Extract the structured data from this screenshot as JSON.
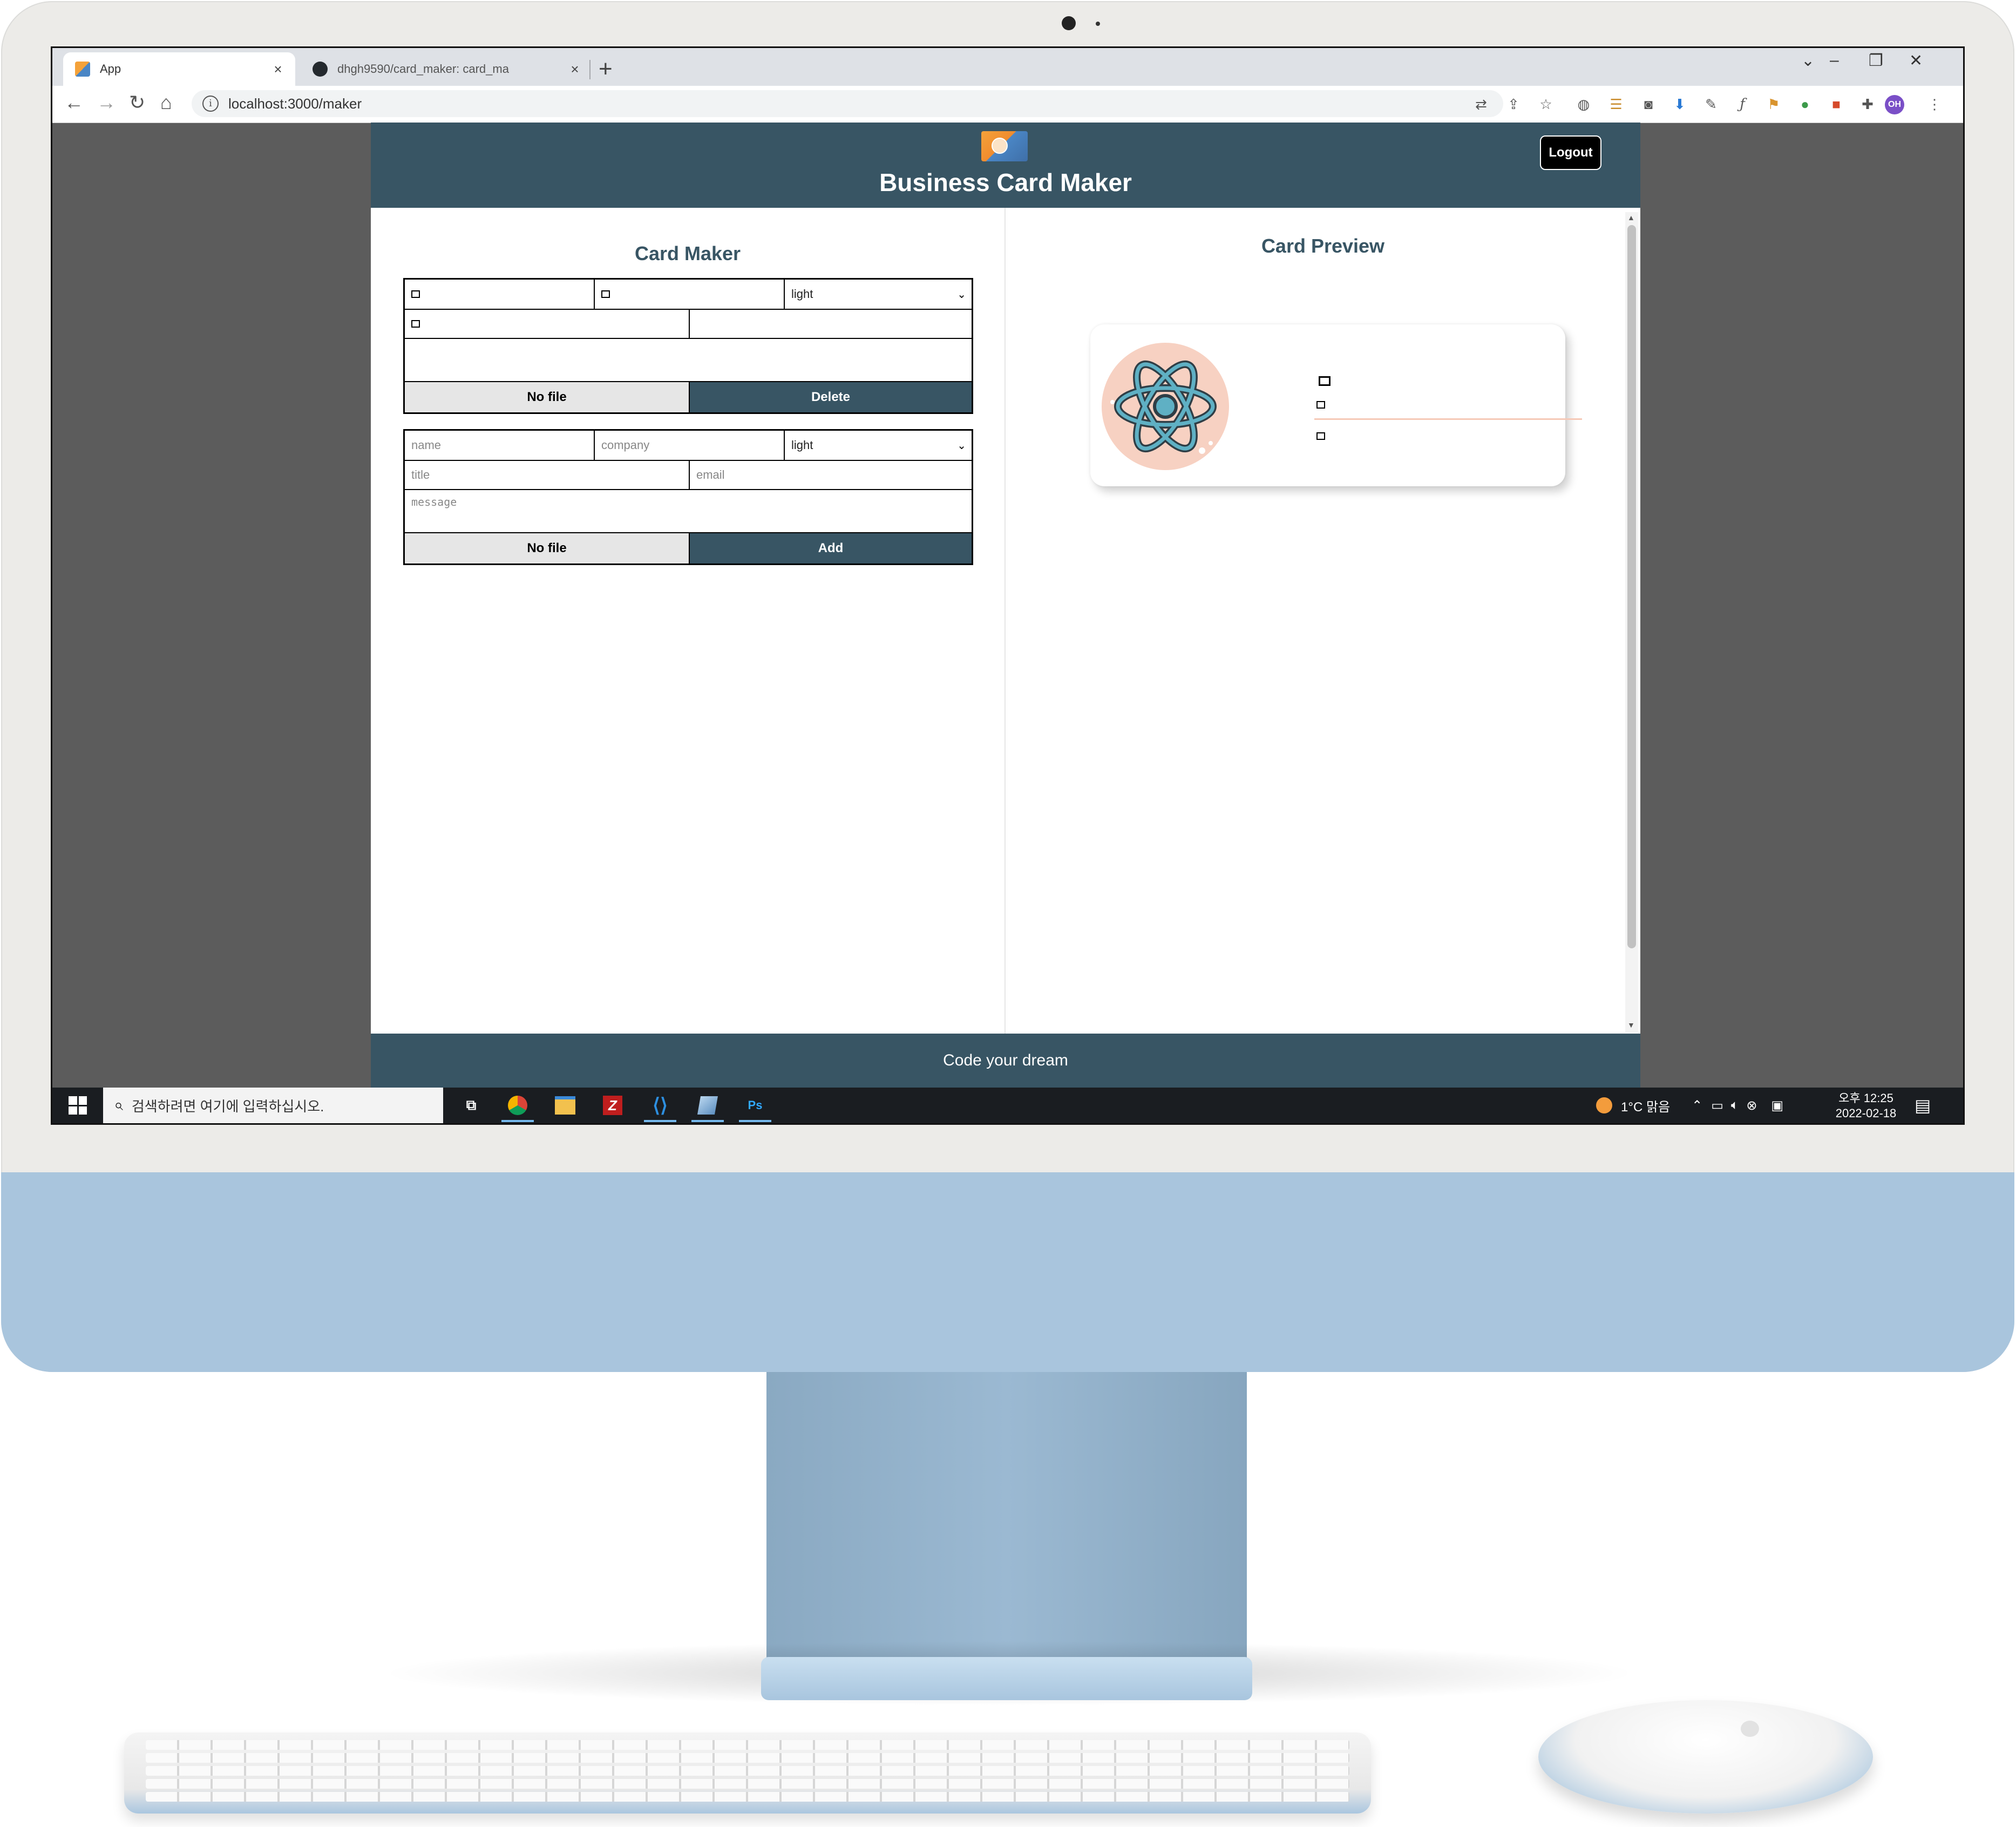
{
  "browser": {
    "tabs": [
      {
        "label": "App"
      },
      {
        "label": "dhgh9590/card_maker: card_ma"
      }
    ],
    "tab_close_symbol": "×",
    "new_tab_symbol": "+",
    "url": "localhost:3000/maker",
    "profile_initials": "OH"
  },
  "app": {
    "title": "Business Card Maker",
    "logout_label": "Logout",
    "footer_text": "Code your dream",
    "maker": {
      "title": "Card Maker",
      "existing_card": {
        "theme": "light",
        "file_label": "No file",
        "delete_label": "Delete"
      },
      "new_card": {
        "name_placeholder": "name",
        "company_placeholder": "company",
        "theme": "light",
        "title_placeholder": "title",
        "email_placeholder": "email",
        "message_placeholder": "message",
        "file_label": "No file",
        "add_label": "Add"
      }
    },
    "preview": {
      "title": "Card Preview"
    }
  },
  "taskbar": {
    "search_placeholder": "검색하려면 여기에 입력하십시오.",
    "weather": "1°C 맑음",
    "time": "오후 12:25",
    "date": "2022-02-18",
    "ps_label": "Ps"
  },
  "colors": {
    "header": "#385564",
    "avatar_bg": "#f7d1c2",
    "monitor_chin": "#a9c5dd"
  }
}
